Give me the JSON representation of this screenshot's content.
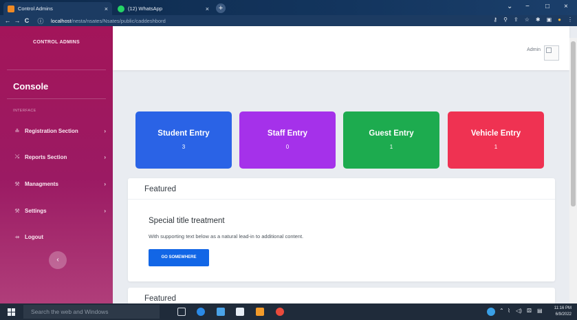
{
  "browser": {
    "tabs": [
      {
        "label": "Control Admins",
        "close": "×",
        "active": true
      },
      {
        "label": "(12) WhatsApp",
        "close": "×",
        "active": false
      }
    ],
    "new_tab": "+",
    "window_controls": [
      "⌄",
      "−",
      "□",
      "×"
    ],
    "nav": {
      "back": "←",
      "forward": "→",
      "reload": "C",
      "info": "ⓘ"
    },
    "url_host": "localhost",
    "url_path": "/nesta/nsates/Nsates/public/caddeshbord",
    "addr_icons": [
      "⚷",
      "⚲",
      "⇪",
      "☆",
      "✱",
      "▣",
      "●",
      "⋮"
    ]
  },
  "sidebar": {
    "brand": "CONTROL ADMINS",
    "console": "Console",
    "section_heading": "INTERFACE",
    "items": [
      {
        "label": "Registration Section",
        "icon": "≗",
        "chevron": "›"
      },
      {
        "label": "Reports Section",
        "icon": "⤯",
        "chevron": "›"
      },
      {
        "label": "Managments",
        "icon": "⚒",
        "chevron": "›"
      },
      {
        "label": "Settings",
        "icon": "⚒",
        "chevron": "›"
      },
      {
        "label": "Logout",
        "icon": "⇸",
        "chevron": ""
      }
    ],
    "collapse_icon": "‹"
  },
  "topbar": {
    "admin_label": "Admin"
  },
  "stats": [
    {
      "title": "Student Entry",
      "count": "3",
      "color": "#2a63e6"
    },
    {
      "title": "Staff Entry",
      "count": "0",
      "color": "#a531ea"
    },
    {
      "title": "Guest Entry",
      "count": "1",
      "color": "#1dab4f"
    },
    {
      "title": "Vehicle Entry",
      "count": "1",
      "color": "#ef3252"
    }
  ],
  "featured": {
    "header": "Featured",
    "title": "Special title treatment",
    "text": "With supporting text below as a natural lead-in to additional content.",
    "button": "GO SOMEWHERE"
  },
  "featured2": {
    "header": "Featured"
  },
  "taskbar": {
    "search_placeholder": "Search the web and Windows",
    "tray": [
      "⌃",
      "⌇",
      "◁)",
      "⚄",
      "▤"
    ],
    "time": "11:16 PM",
    "date": "6/9/2022"
  }
}
